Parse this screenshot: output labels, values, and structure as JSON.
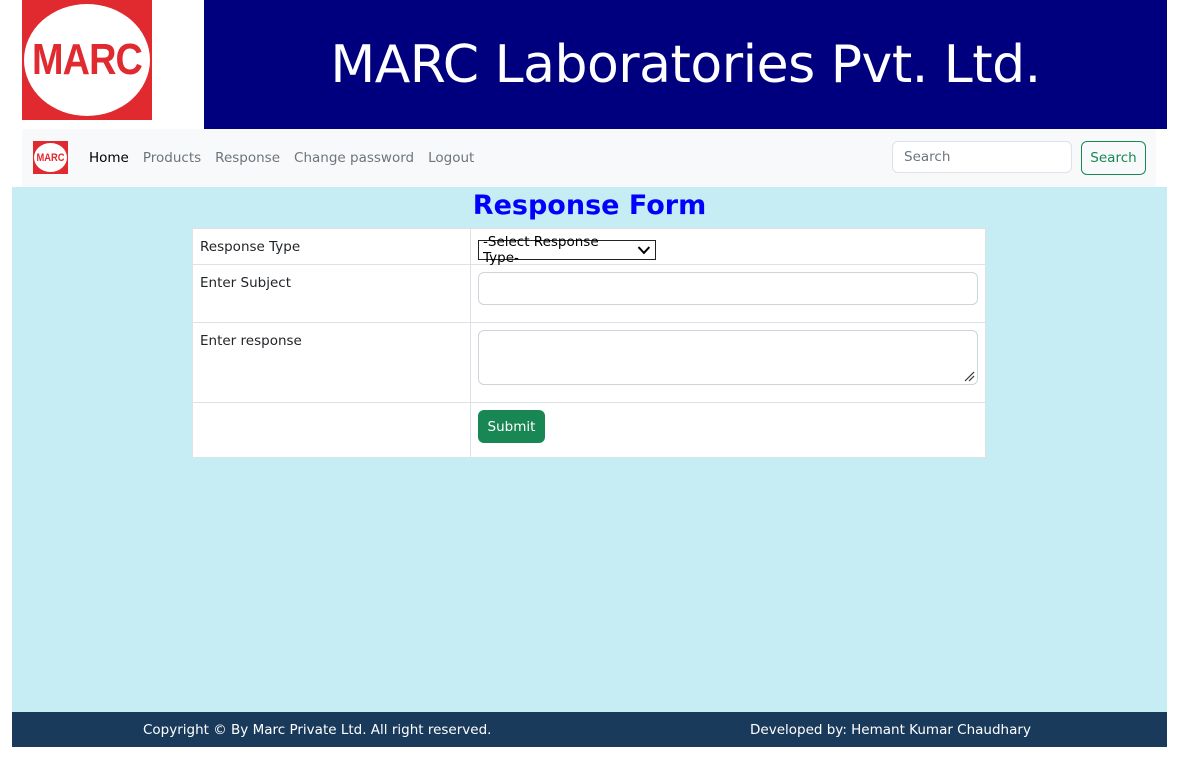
{
  "header": {
    "logo_text": "MARC",
    "company_name": "MARC Laboratories Pvt. Ltd."
  },
  "navbar": {
    "brand_logo_text": "MARC",
    "links": [
      {
        "label": "Home",
        "active": true
      },
      {
        "label": "Products",
        "active": false
      },
      {
        "label": "Response",
        "active": false
      },
      {
        "label": "Change password",
        "active": false
      },
      {
        "label": "Logout",
        "active": false
      }
    ],
    "search_placeholder": "Search",
    "search_button_label": "Search"
  },
  "form": {
    "title": "Response Form",
    "response_type_label": "Response Type",
    "response_type_selected": "-Select Response Type-",
    "subject_label": "Enter Subject",
    "subject_value": "",
    "response_label": "Enter response",
    "response_value": "",
    "submit_label": "Submit"
  },
  "footer": {
    "copyright": "Copyright © By Marc Private Ltd. All right reserved.",
    "developer": "Developed by: Hemant Kumar Chaudhary"
  },
  "colors": {
    "banner": "#00007f",
    "logo_red": "#e02a2f",
    "main_background": "#c5edf3",
    "title_blue": "#0000ff",
    "success_green": "#198754",
    "footer": "#1a3a5c"
  },
  "icons": {
    "select_arrow": "chevron-down-icon",
    "textarea_resize": "resize-handle-icon"
  }
}
